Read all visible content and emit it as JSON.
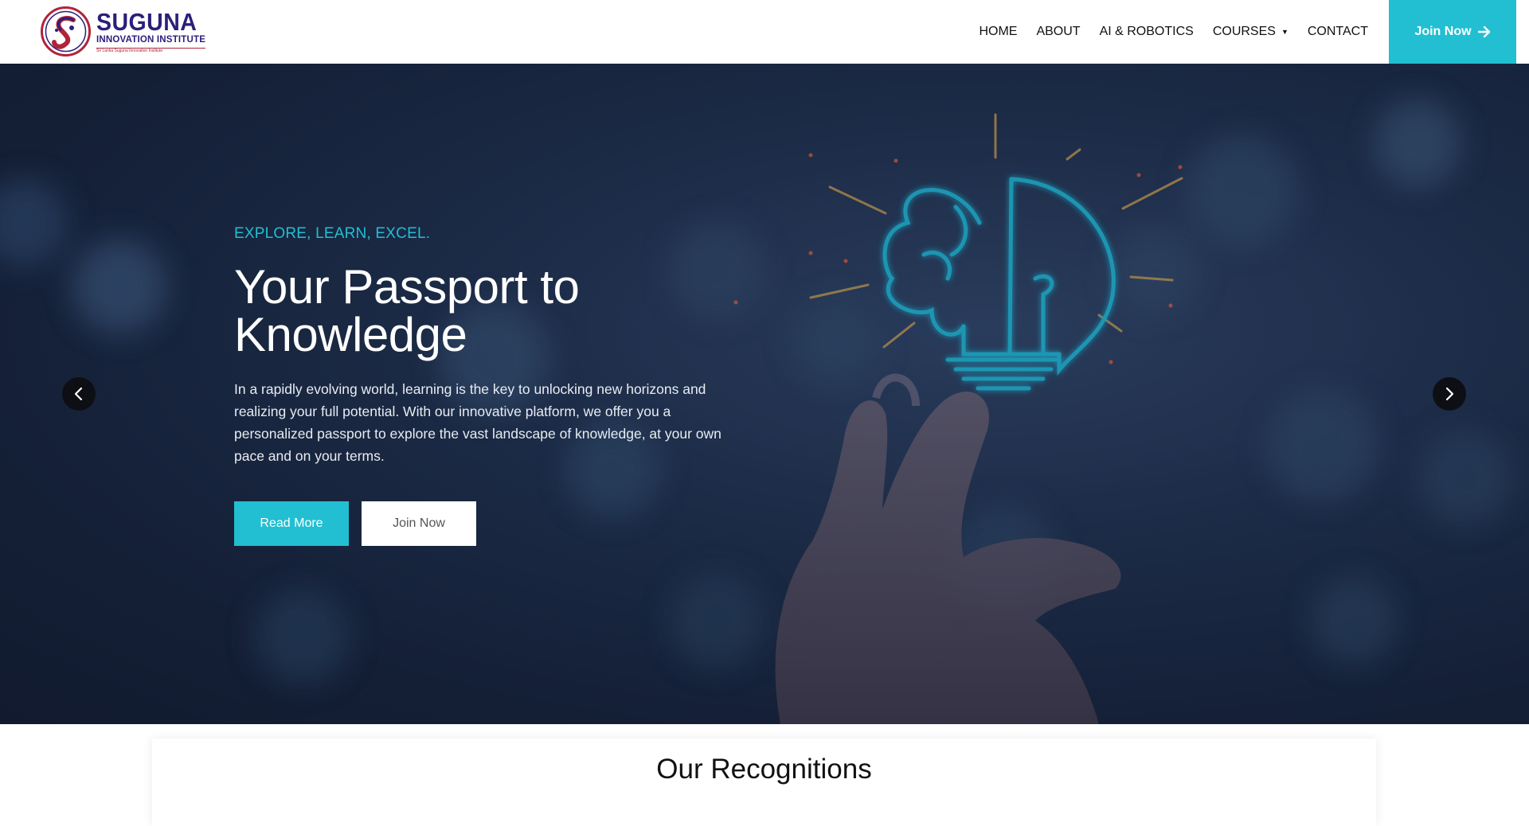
{
  "header": {
    "logo": {
      "brand": "SUGUNA",
      "subtitle": "INNOVATION INSTITUTE",
      "tagline": "Sri Lanka Suguna Innovation Institute"
    },
    "nav": [
      {
        "label": "HOME",
        "icon": ""
      },
      {
        "label": "ABOUT",
        "icon": ""
      },
      {
        "label": "AI & ROBOTICS",
        "icon": ""
      },
      {
        "label": "COURSES",
        "icon": "chevron-down-icon"
      },
      {
        "label": "CONTACT",
        "icon": ""
      }
    ],
    "cta": {
      "label": "Join Now",
      "icon": "arrow-right-icon"
    }
  },
  "hero": {
    "tagline": "EXPLORE, LEARN, EXCEL.",
    "title_line1": "Your Passport to",
    "title_line2": "Knowledge",
    "description": "In a rapidly evolving world, learning is the key to unlocking new horizons and realizing your full potential. With our innovative platform, we offer you a personalized passport to explore the vast landscape of knowledge, at your own pace and on your terms.",
    "buttons": {
      "read_more": "Read More",
      "join_now": "Join Now"
    },
    "prev_icon": "chevron-left-icon",
    "next_icon": "chevron-right-icon"
  },
  "recognitions": {
    "title": "Our Recognitions"
  },
  "colors": {
    "accent": "#22bfd2",
    "brand_navy": "#2a1f7a",
    "brand_red": "#b0243a",
    "hero_bg": "#141f36"
  }
}
